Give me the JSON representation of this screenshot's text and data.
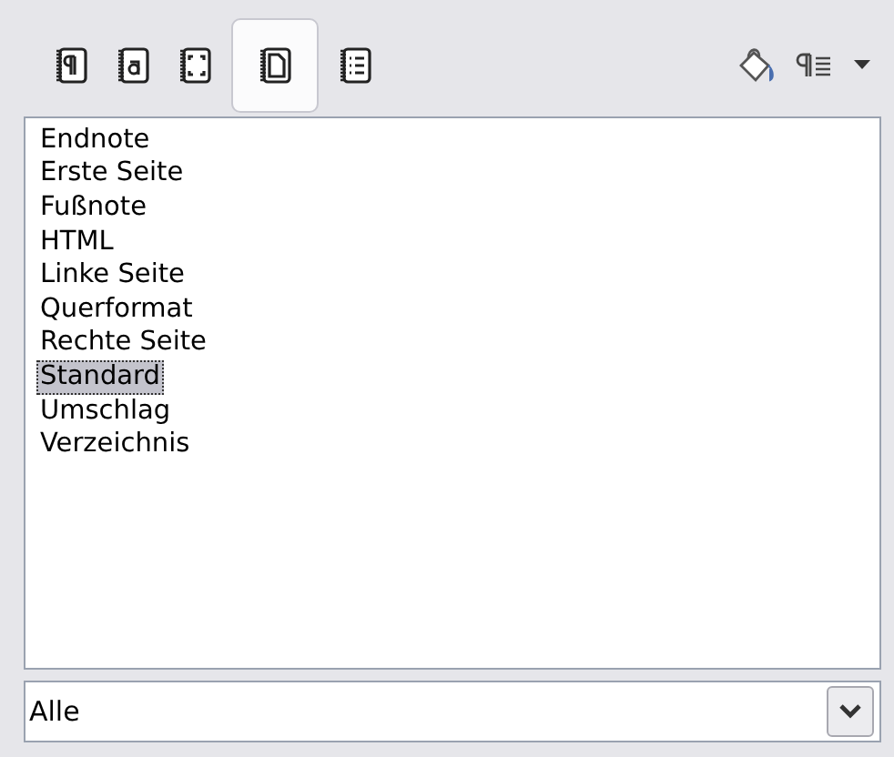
{
  "toolbar": {
    "style_families": [
      {
        "selected": false
      },
      {
        "selected": false
      },
      {
        "selected": false
      },
      {
        "selected": true
      },
      {
        "selected": false
      }
    ]
  },
  "styles_list": {
    "items": [
      {
        "label": "Endnote",
        "selected": false
      },
      {
        "label": "Erste Seite",
        "selected": false
      },
      {
        "label": "Fußnote",
        "selected": false
      },
      {
        "label": "HTML",
        "selected": false
      },
      {
        "label": "Linke Seite",
        "selected": false
      },
      {
        "label": "Querformat",
        "selected": false
      },
      {
        "label": "Rechte Seite",
        "selected": false
      },
      {
        "label": "Standard",
        "selected": true
      },
      {
        "label": "Umschlag",
        "selected": false
      },
      {
        "label": "Verzeichnis",
        "selected": false
      }
    ]
  },
  "filter": {
    "value": "Alle"
  }
}
